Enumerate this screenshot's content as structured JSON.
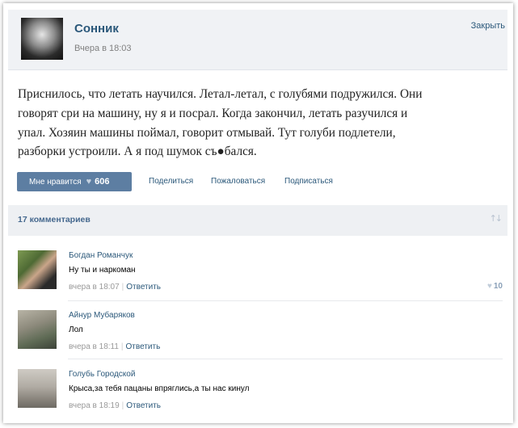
{
  "post": {
    "author": "Сонник",
    "time": "Вчера в 18:03",
    "close": "Закрыть",
    "text_lines": [
      "Приснилось, что летать научился. Летал-летал, с голубями подружился. Они",
      "говорят сри на машину, ну я и посрал. Когда закончил, летать разучился и",
      "упал. Хозяин машины поймал, говорит отмывай. Тут голуби подлетели,",
      "разборки устроили. А я под шумок съ●бался."
    ]
  },
  "actions": {
    "like_label": "Мне нравится",
    "like_count": "606",
    "share": "Поделиться",
    "report": "Пожаловаться",
    "subscribe": "Подписаться"
  },
  "comments_header": {
    "count_label": "17 комментариев"
  },
  "comments": [
    {
      "author": "Богдан Романчук",
      "text": "Ну ты и наркоман",
      "time": "вчера в 18:07",
      "reply": "Ответить",
      "likes": "10"
    },
    {
      "author": "Айнур Мубаряков",
      "text": "Лол",
      "time": "вчера в 18:11",
      "reply": "Ответить"
    },
    {
      "author": "Голубь Городской",
      "text": "Крыса,за тебя пацаны впряглись,а ты нас кинул",
      "time": "вчера в 18:19",
      "reply": "Ответить"
    }
  ],
  "colors": {
    "link": "#2b587a",
    "button": "#5d7ea2",
    "header_bg": "#f0f2f5"
  }
}
